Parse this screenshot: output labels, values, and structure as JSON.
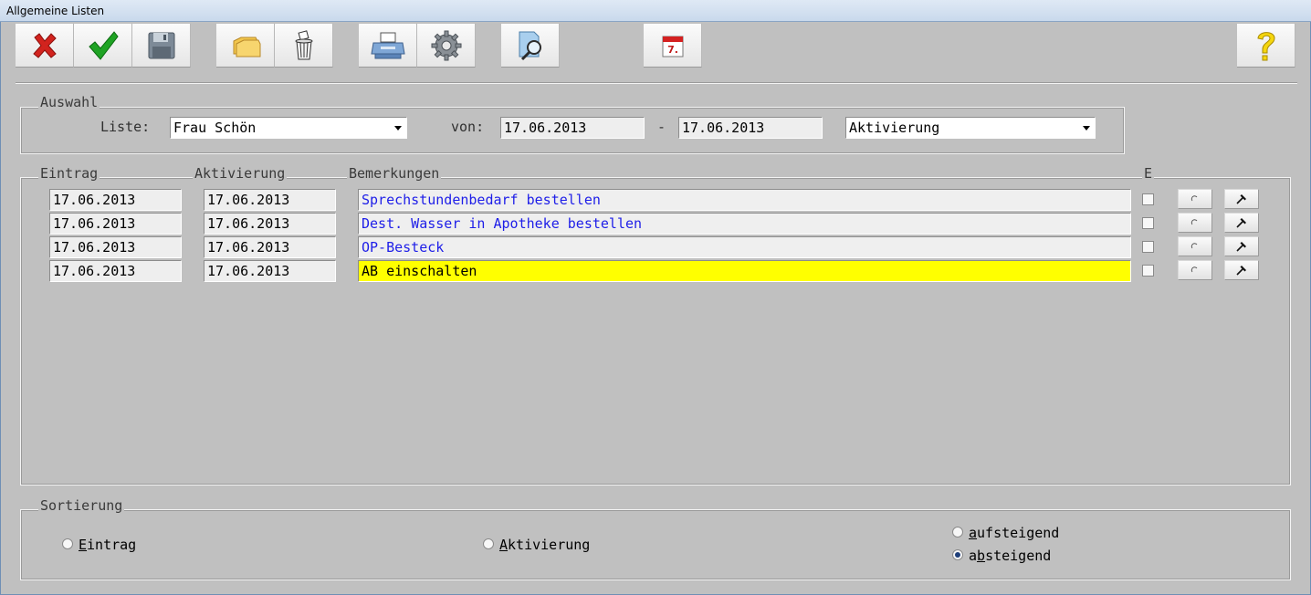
{
  "window": {
    "title": "Allgemeine Listen"
  },
  "toolbar": {
    "buttons": [
      {
        "name": "cancel-button",
        "icon": "red-x-icon"
      },
      {
        "name": "ok-button",
        "icon": "green-check-icon"
      },
      {
        "name": "save-button",
        "icon": "floppy-disk-icon"
      },
      {
        "name": "folders-button",
        "icon": "folders-icon"
      },
      {
        "name": "delete-button",
        "icon": "trash-bin-icon"
      },
      {
        "name": "print-button",
        "icon": "printer-icon"
      },
      {
        "name": "settings-button",
        "icon": "gear-icon"
      },
      {
        "name": "search-button",
        "icon": "document-search-icon"
      },
      {
        "name": "calendar-button",
        "icon": "calendar-icon"
      },
      {
        "name": "help-button",
        "icon": "question-mark-icon"
      }
    ]
  },
  "auswahl": {
    "group_label": "Auswahl",
    "liste_label": "Liste:",
    "liste_value": "Frau Schön",
    "von_label": "von:",
    "date_from": "17.06.2013",
    "dash": "-",
    "date_to": "17.06.2013",
    "type_value": "Aktivierung"
  },
  "table": {
    "headers": {
      "eintrag": "Eintrag",
      "aktivierung": "Aktivierung",
      "bemerkungen": "Bemerkungen",
      "e": "E"
    },
    "rows": [
      {
        "eintrag": "17.06.2013",
        "aktivierung": "17.06.2013",
        "bemerkung": "Sprechstundenbedarf bestellen",
        "highlight": false
      },
      {
        "eintrag": "17.06.2013",
        "aktivierung": "17.06.2013",
        "bemerkung": "Dest. Wasser in Apotheke bestellen",
        "highlight": false
      },
      {
        "eintrag": "17.06.2013",
        "aktivierung": "17.06.2013",
        "bemerkung": "OP-Besteck",
        "highlight": false
      },
      {
        "eintrag": "17.06.2013",
        "aktivierung": "17.06.2013",
        "bemerkung": "AB einschalten",
        "highlight": true
      }
    ],
    "remark_color": "#1e1ee8",
    "highlight_color": "#ffff00"
  },
  "sortierung": {
    "group_label": "Sortierung",
    "eintrag": {
      "accel": "E",
      "rest": "intrag",
      "checked": false
    },
    "aktivierung": {
      "accel": "A",
      "rest": "ktivierung",
      "checked": false
    },
    "aufsteigend": {
      "accel": "a",
      "rest": "ufsteigend",
      "checked": false
    },
    "absteigend": {
      "pre": "a",
      "accel": "b",
      "rest": "steigend",
      "checked": true
    }
  }
}
